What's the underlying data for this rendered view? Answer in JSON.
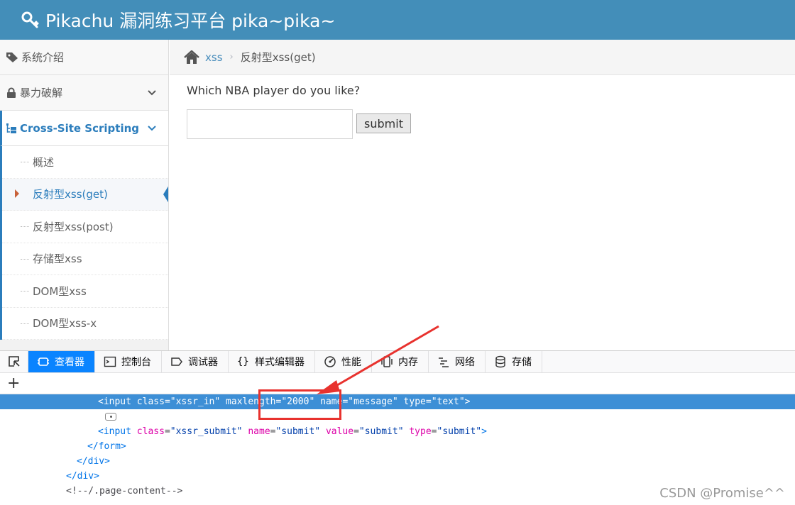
{
  "header": {
    "title": "Pikachu 漏洞练习平台 pika~pika~"
  },
  "sidebar": {
    "items": [
      {
        "label": "系统介绍"
      },
      {
        "label": "暴力破解"
      },
      {
        "label": "Cross-Site Scripting"
      }
    ],
    "sub_items": [
      {
        "label": "概述"
      },
      {
        "label": "反射型xss(get)"
      },
      {
        "label": "反射型xss(post)"
      },
      {
        "label": "存储型xss"
      },
      {
        "label": "DOM型xss"
      },
      {
        "label": "DOM型xss-x"
      }
    ]
  },
  "breadcrumb": {
    "link": "xss",
    "separator": "›",
    "current": "反射型xss(get)"
  },
  "main": {
    "question": "Which NBA player do you like?",
    "submit_label": "submit"
  },
  "devtools": {
    "tabs": [
      "查看器",
      "控制台",
      "调试器",
      "样式编辑器",
      "性能",
      "内存",
      "网络",
      "存储"
    ],
    "add_label": "+",
    "markup": {
      "input1": {
        "open": "<input",
        "a1": "class",
        "v1": "\"xssr_in\"",
        "a2": "maxlength",
        "v2": "\"2000\"",
        "a3": "name",
        "v3": "\"message\"",
        "a4": "type",
        "v4": "\"text\"",
        "close": ">"
      },
      "input2": {
        "open": "<input",
        "a1": "class",
        "v1": "\"xssr_submit\"",
        "a2": "name",
        "v2": "\"submit\"",
        "a3": "value",
        "v3": "\"submit\"",
        "a4": "type",
        "v4": "\"submit\"",
        "close": ">"
      },
      "form_close": "</form>",
      "div_close1": "</div>",
      "div_close2": "</div>",
      "comment": "<!--/.page-content-->"
    }
  },
  "watermark": "CSDN @Promise^^",
  "colors": {
    "header": "#438eb9",
    "accent": "#2b7dbc",
    "selection": "#3d8fd6",
    "annotation": "#e8322e"
  },
  "icons": [
    "key-icon",
    "tag-icon",
    "lock-icon",
    "sitemap-icon",
    "chevron-down-icon",
    "home-icon",
    "element-picker-icon",
    "inspector-icon",
    "console-icon",
    "debugger-icon",
    "style-editor-icon",
    "performance-icon",
    "memory-icon",
    "network-icon",
    "storage-icon"
  ]
}
